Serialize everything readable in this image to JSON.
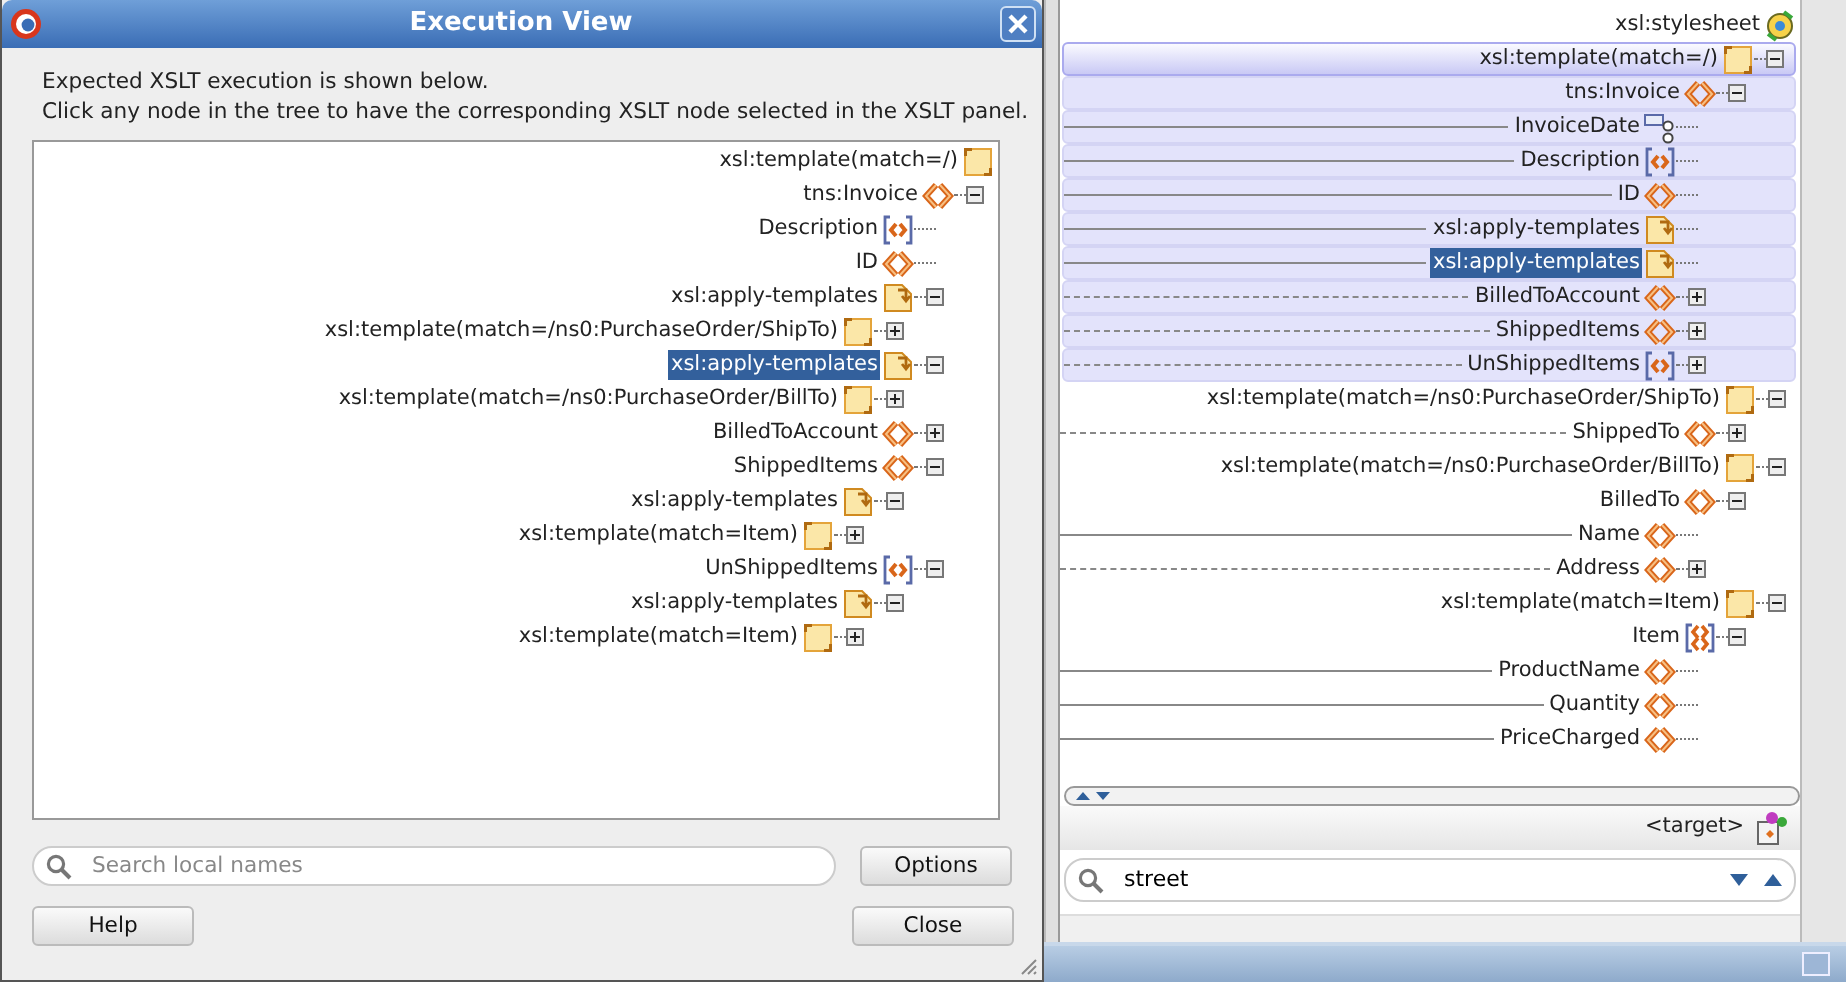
{
  "dialog": {
    "title": "Execution View",
    "description": [
      "Expected XSLT execution is shown below.",
      "Click any node in the tree to have the corresponding XSLT node selected in the XSLT panel."
    ],
    "tree": [
      {
        "label": "xsl:template(match=/)",
        "kind": "template",
        "selected": false,
        "children": [
          {
            "label": "tns:Invoice",
            "kind": "element",
            "selected": false,
            "expanded": true,
            "children": [
              {
                "label": "Description",
                "kind": "optional-element",
                "selected": false
              },
              {
                "label": "ID",
                "kind": "element",
                "selected": false
              },
              {
                "label": "xsl:apply-templates",
                "kind": "apply",
                "selected": false,
                "expanded": true,
                "children": [
                  {
                    "label": "xsl:template(match=/ns0:PurchaseOrder/ShipTo)",
                    "kind": "template",
                    "selected": false,
                    "expanded": false
                  }
                ]
              },
              {
                "label": "xsl:apply-templates",
                "kind": "apply",
                "selected": true,
                "expanded": true,
                "children": [
                  {
                    "label": "xsl:template(match=/ns0:PurchaseOrder/BillTo)",
                    "kind": "template",
                    "selected": false,
                    "expanded": false
                  }
                ]
              },
              {
                "label": "BilledToAccount",
                "kind": "element",
                "selected": false,
                "expanded": false
              },
              {
                "label": "ShippedItems",
                "kind": "element",
                "selected": false,
                "expanded": true,
                "children": [
                  {
                    "label": "xsl:apply-templates",
                    "kind": "apply",
                    "selected": false,
                    "expanded": true,
                    "children": [
                      {
                        "label": "xsl:template(match=Item)",
                        "kind": "template",
                        "selected": false,
                        "expanded": false
                      }
                    ]
                  }
                ]
              },
              {
                "label": "UnShippedItems",
                "kind": "optional-element",
                "selected": false,
                "expanded": true,
                "children": [
                  {
                    "label": "xsl:apply-templates",
                    "kind": "apply",
                    "selected": false,
                    "expanded": true,
                    "children": [
                      {
                        "label": "xsl:template(match=Item)",
                        "kind": "template",
                        "selected": false,
                        "expanded": false
                      }
                    ]
                  }
                ]
              }
            ]
          }
        ]
      }
    ],
    "search": {
      "placeholder": "Search local names"
    },
    "options_button": "Options",
    "help_button": "Help",
    "close_button": "Close"
  },
  "panel": {
    "tree": [
      {
        "label": "xsl:stylesheet",
        "kind": "stylesheet",
        "selected": false,
        "children": [
          {
            "label": "xsl:template(match=/)",
            "kind": "template",
            "selected": false,
            "expanded": true,
            "band": true,
            "children": [
              {
                "label": "tns:Invoice",
                "kind": "element",
                "selected": false,
                "expanded": true,
                "children": [
                  {
                    "label": "InvoiceDate",
                    "kind": "attribute",
                    "selected": false,
                    "mapped": true,
                    "dashed": false
                  },
                  {
                    "label": "Description",
                    "kind": "optional-element",
                    "selected": false,
                    "mapped": true,
                    "dashed": false
                  },
                  {
                    "label": "ID",
                    "kind": "element",
                    "selected": false,
                    "mapped": true,
                    "dashed": false
                  },
                  {
                    "label": "xsl:apply-templates",
                    "kind": "apply",
                    "selected": false,
                    "mapped": true,
                    "dashed": false
                  },
                  {
                    "label": "xsl:apply-templates",
                    "kind": "apply",
                    "selected": true,
                    "mapped": true,
                    "dashed": false
                  },
                  {
                    "label": "BilledToAccount",
                    "kind": "element",
                    "selected": false,
                    "expanded": false,
                    "mapped": true,
                    "dashed": true
                  },
                  {
                    "label": "ShippedItems",
                    "kind": "element",
                    "selected": false,
                    "expanded": false,
                    "mapped": true,
                    "dashed": true
                  },
                  {
                    "label": "UnShippedItems",
                    "kind": "optional-element",
                    "selected": false,
                    "expanded": false,
                    "mapped": true,
                    "dashed": true
                  }
                ]
              }
            ]
          },
          {
            "label": "xsl:template(match=/ns0:PurchaseOrder/ShipTo)",
            "kind": "template",
            "selected": false,
            "expanded": true,
            "children": [
              {
                "label": "ShippedTo",
                "kind": "element",
                "selected": false,
                "expanded": false,
                "mapped": true,
                "dashed": true
              }
            ]
          },
          {
            "label": "xsl:template(match=/ns0:PurchaseOrder/BillTo)",
            "kind": "template",
            "selected": false,
            "expanded": true,
            "children": [
              {
                "label": "BilledTo",
                "kind": "element",
                "selected": false,
                "expanded": true,
                "children": [
                  {
                    "label": "Name",
                    "kind": "element",
                    "selected": false,
                    "mapped": true,
                    "dashed": false
                  },
                  {
                    "label": "Address",
                    "kind": "element",
                    "selected": false,
                    "expanded": false,
                    "mapped": true,
                    "dashed": true
                  }
                ]
              }
            ]
          },
          {
            "label": "xsl:template(match=Item)",
            "kind": "template",
            "selected": false,
            "expanded": true,
            "children": [
              {
                "label": "Item",
                "kind": "repeating-element",
                "selected": false,
                "expanded": true,
                "children": [
                  {
                    "label": "ProductName",
                    "kind": "element",
                    "selected": false,
                    "mapped": true,
                    "dashed": false
                  },
                  {
                    "label": "Quantity",
                    "kind": "element",
                    "selected": false,
                    "mapped": true,
                    "dashed": false
                  },
                  {
                    "label": "PriceCharged",
                    "kind": "element",
                    "selected": false,
                    "mapped": true,
                    "dashed": false
                  }
                ]
              }
            ]
          }
        ]
      }
    ],
    "target_label": "<target>",
    "search": {
      "value": "street"
    }
  }
}
